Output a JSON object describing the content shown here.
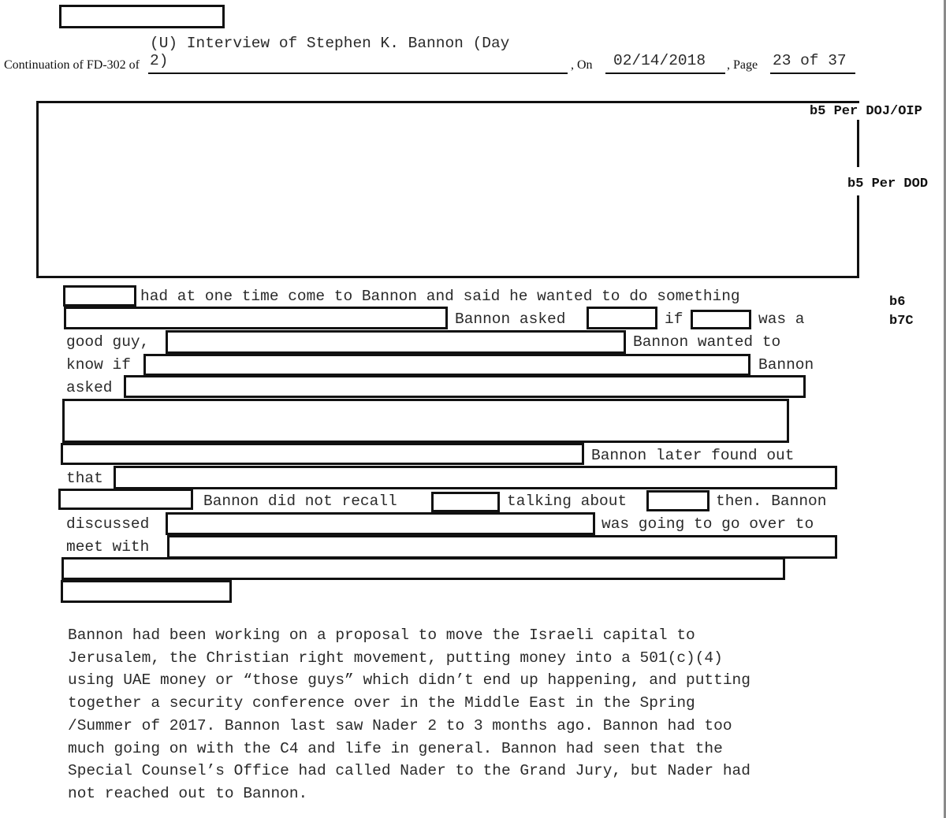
{
  "header": {
    "form_label": "Continuation of FD-302 of",
    "subject_line1": "(U) Interview of Stephen K. Bannon (Day",
    "subject_line2": "2)",
    "on_label": ", On",
    "date": "02/14/2018",
    "page_label": ", Page",
    "page": "23 of 37"
  },
  "exemptions": {
    "b5_doj": "b5 Per DOJ/OIP",
    "b5_dod": "b5 Per DOD",
    "b6": "b6",
    "b7c": "b7C"
  },
  "redacted_lines": {
    "l1_a": "had at one time come to Bannon and said he wanted to do something",
    "l2_a": "Bannon asked",
    "l2_b": "if",
    "l2_c": "was a",
    "l3_a": "good guy,",
    "l3_b": "Bannon wanted to",
    "l4_a": "know if",
    "l4_b": "Bannon",
    "l5_a": "asked",
    "l7_a": "Bannon later found out",
    "l8_a": "that",
    "l9_a": "Bannon did not recall",
    "l9_b": "talking about",
    "l9_c": "then. Bannon",
    "l10_a": "discussed",
    "l10_b": "was going to go over to",
    "l11_a": "meet with"
  },
  "paragraph": {
    "lines": [
      "Bannon had been working on a proposal to move the Israeli capital to",
      "Jerusalem, the Christian right movement, putting money into a 501(c)(4)",
      "using UAE money or “those guys” which didn’t end up happening, and putting",
      "together a security conference over in the Middle East in the Spring",
      "/Summer of 2017. Bannon last saw Nader 2 to 3 months ago. Bannon had too",
      "much going on with the C4 and life in general. Bannon had seen that the",
      "Special Counsel’s Office had called Nader to the Grand Jury, but Nader had",
      "not reached out to Bannon."
    ]
  }
}
